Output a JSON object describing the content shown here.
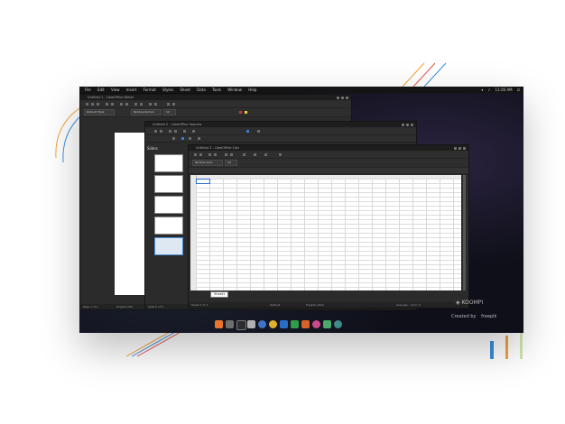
{
  "desktop": {
    "menu_items": [
      "File",
      "Edit",
      "View",
      "Insert",
      "Format",
      "Styles",
      "Sheet",
      "Data",
      "Tools",
      "Window",
      "Help"
    ],
    "clock": "11:26 AM"
  },
  "writer": {
    "title": "Untitled 1 - LibreOffice Writer",
    "paragraph_style": "Default Style",
    "font_name": "Nimbus Roman",
    "font_size": "12",
    "status_page": "Page 1 of 1",
    "status_lang": "English (UK)"
  },
  "impress": {
    "title": "Untitled 2 - LibreOffice Impress",
    "slides_label": "Slides",
    "status_slide": "Slide 5 of 5"
  },
  "calc": {
    "title": "Untitled 3 - LibreOffice Calc",
    "font_name": "Nimbus Sans",
    "font_size": "10",
    "sheet_tab": "Sheet1",
    "status_sheet": "Sheet 1 of 1",
    "status_style": "Default",
    "status_lang": "English (USA)",
    "status_sum": "Average: ; Sum: 0"
  },
  "watermark": {
    "brand": "KOOMPI",
    "credit_label": "Created by",
    "credit_brand": "freepik"
  },
  "colors": {
    "desktop_bg": "#0e0f18",
    "window_bg": "#2b2b2b",
    "deco_orange": "#f2a23a",
    "deco_blue": "#3b8fe0",
    "deco_red": "#e5554f",
    "deco_green": "#7bc47f"
  }
}
